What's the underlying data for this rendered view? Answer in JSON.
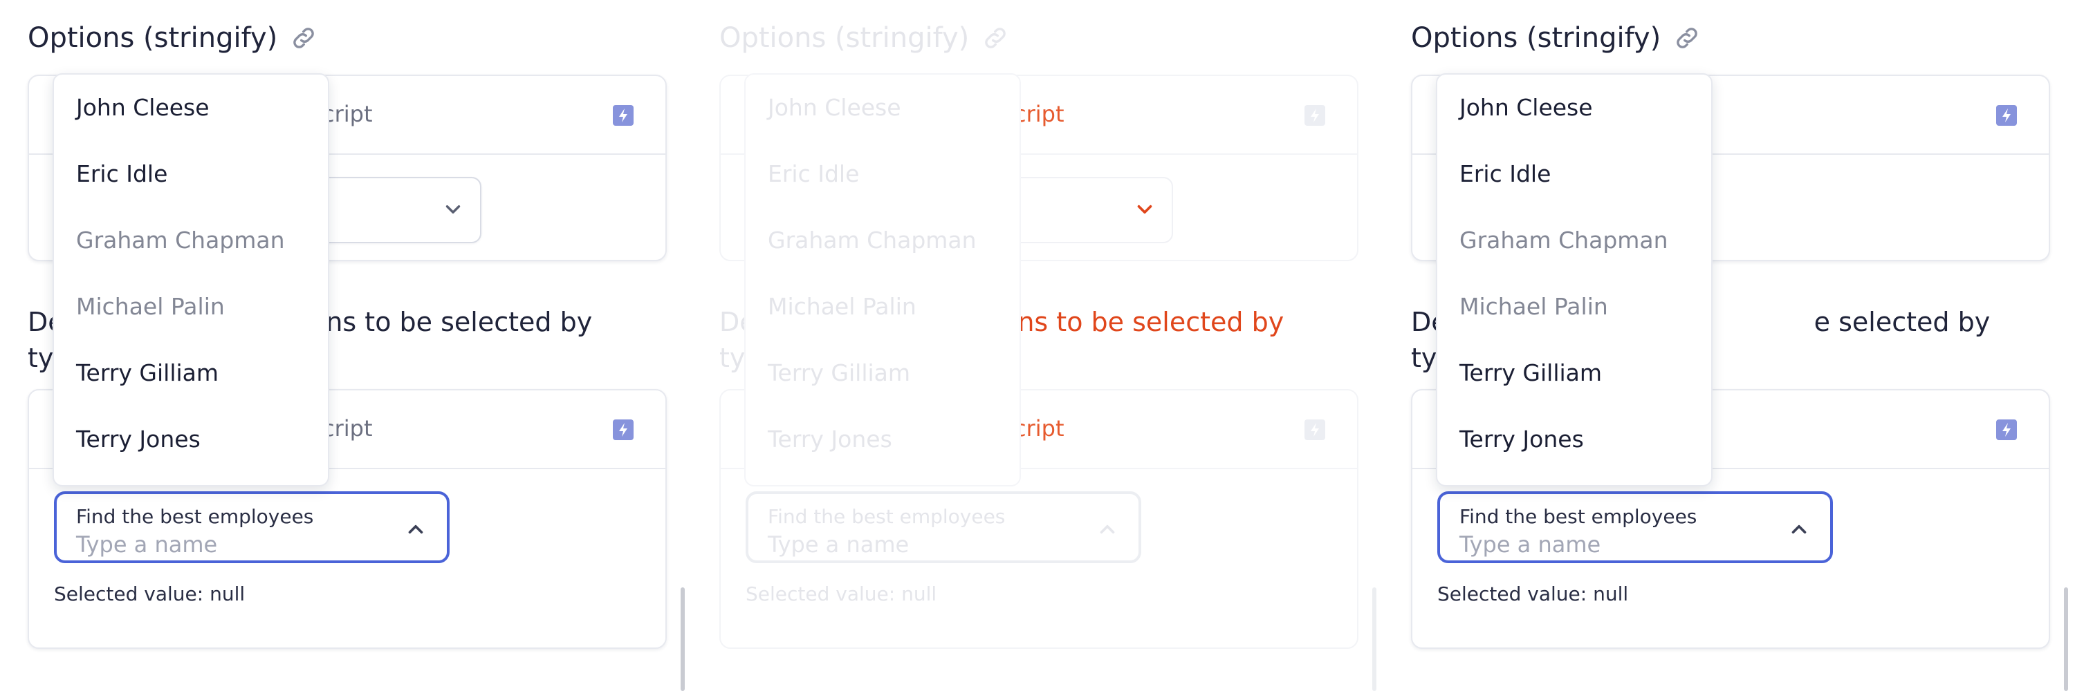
{
  "section": {
    "title": "Options (stringify)",
    "link_icon": "link-icon"
  },
  "demo": {
    "language_partial": "cript",
    "run_icon": "bolt-icon",
    "field_label": "Find the best employees",
    "placeholder": "Type a name",
    "selected_text": "Selected value: null"
  },
  "heading2": {
    "left_fragment": "De",
    "left_fragment_2": "ty",
    "right_fragment": "tions to be selected by",
    "right_fragment_p3": "e selected by"
  },
  "options": [
    {
      "label": "John Cleese",
      "disabled": false
    },
    {
      "label": "Eric Idle",
      "disabled": false
    },
    {
      "label": "Graham Chapman",
      "disabled": true
    },
    {
      "label": "Michael Palin",
      "disabled": true
    },
    {
      "label": "Terry Gilliam",
      "disabled": false
    },
    {
      "label": "Terry Jones",
      "disabled": false
    }
  ],
  "colors": {
    "accent": "#4a63d8",
    "bolt": "#8793dc",
    "highlight": "#e0461b"
  }
}
